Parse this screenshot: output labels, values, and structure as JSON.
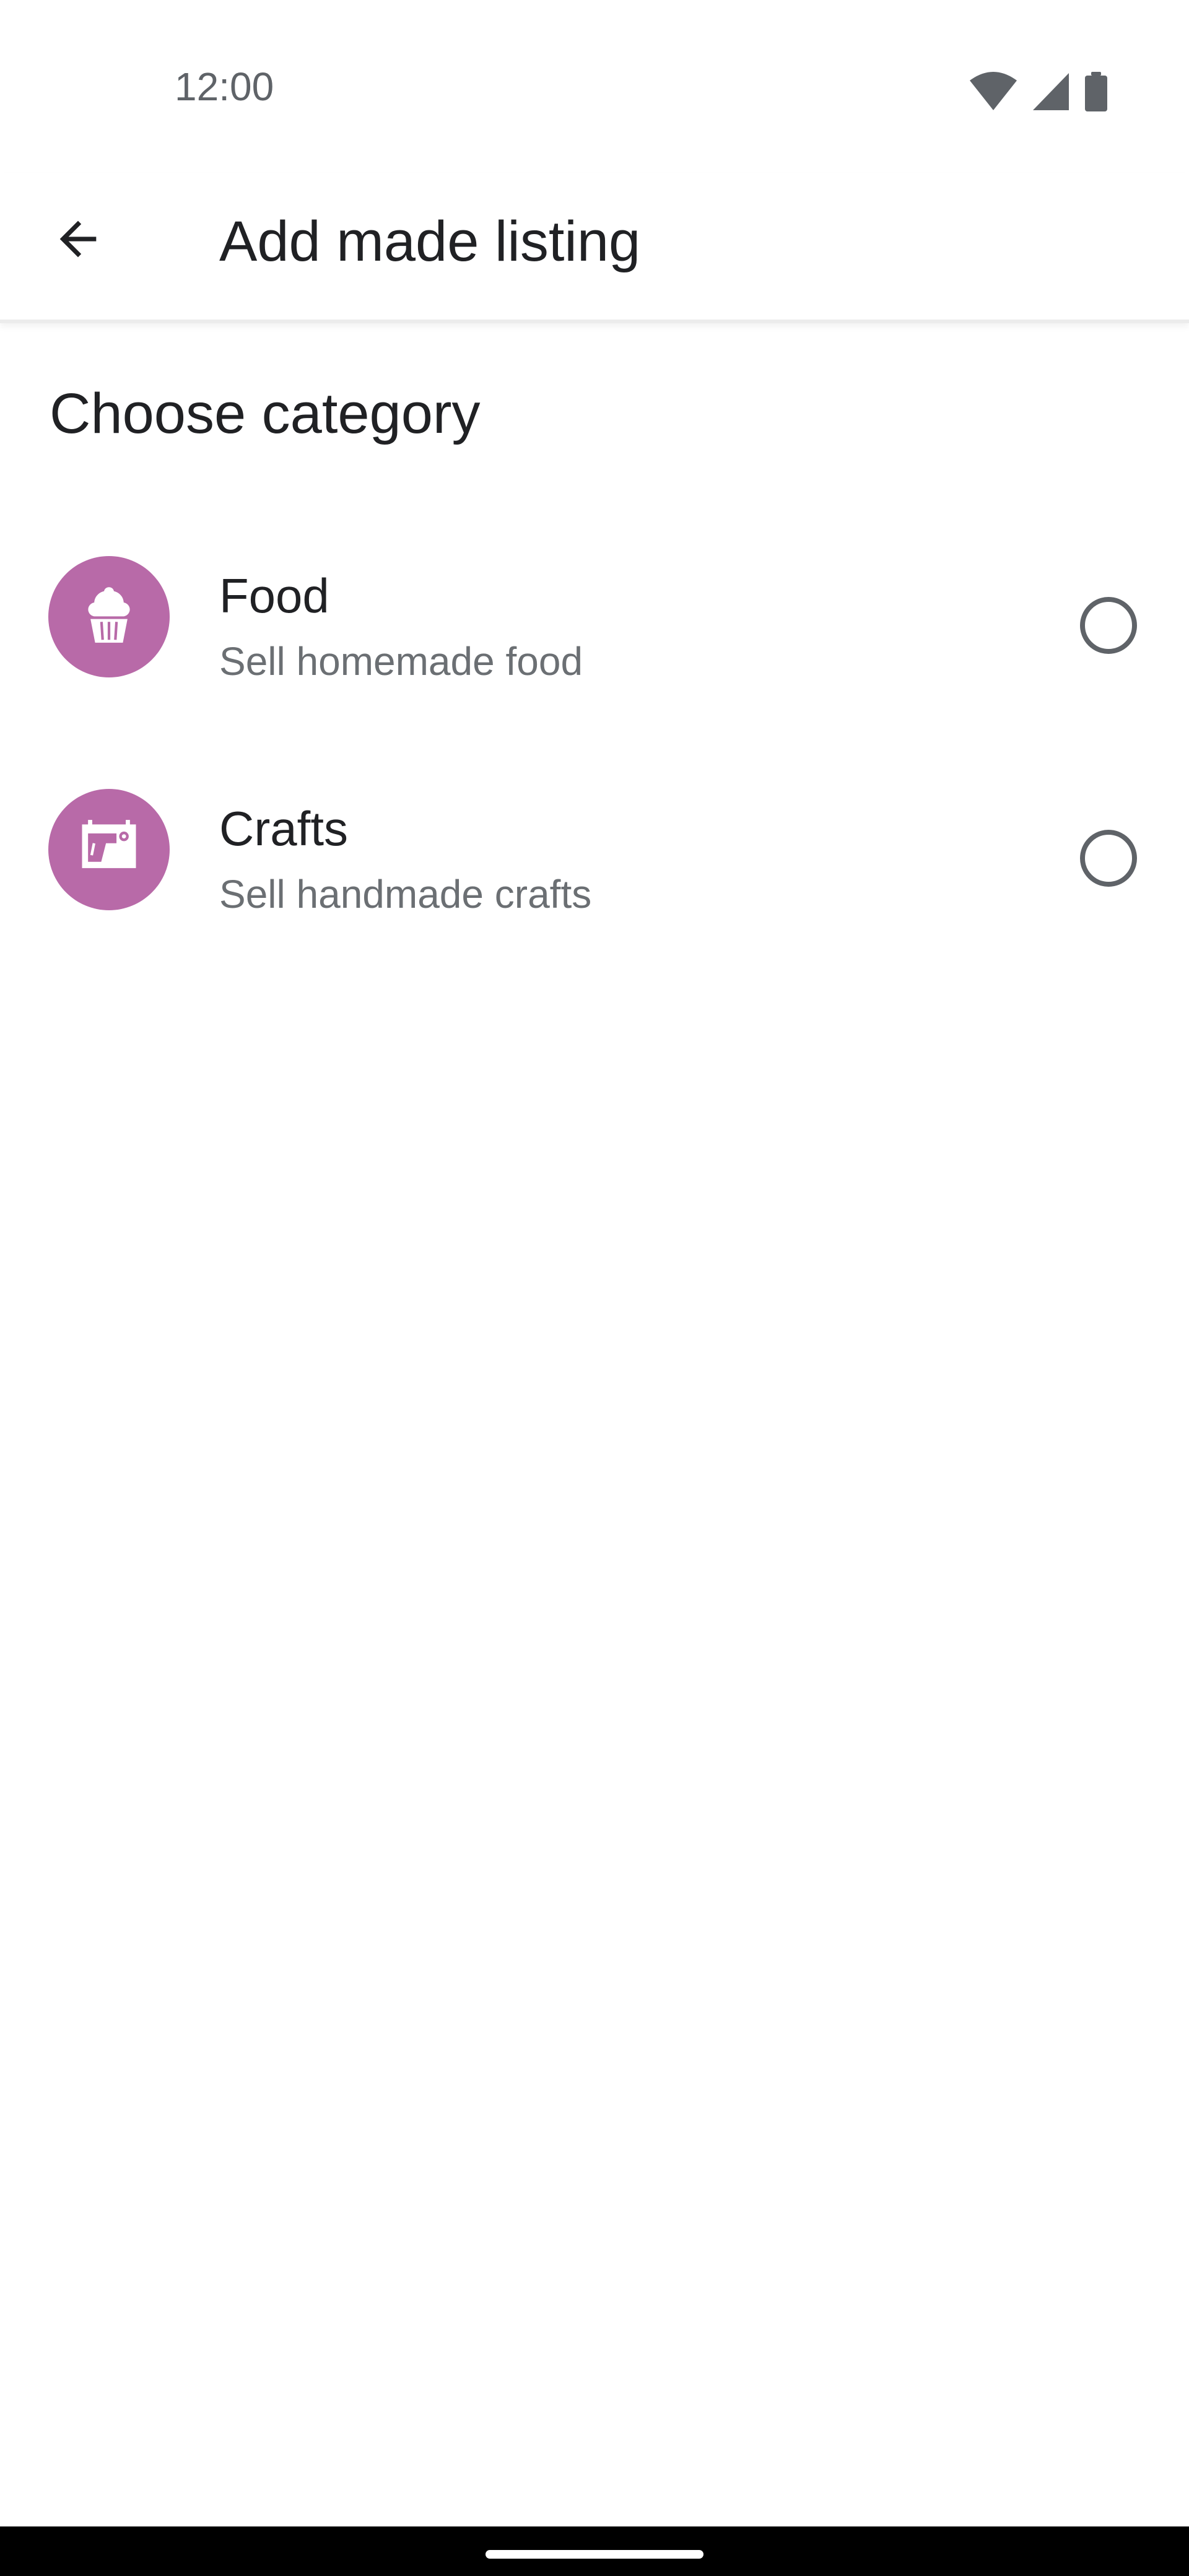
{
  "status_bar": {
    "time": "12:00",
    "icons": [
      "wifi-icon",
      "signal-icon",
      "battery-icon"
    ]
  },
  "app_bar": {
    "back_icon": "arrow-back-icon",
    "title": "Add made listing"
  },
  "content": {
    "section_title": "Choose category",
    "options": [
      {
        "icon": "cupcake-icon",
        "title": "Food",
        "subtitle": "Sell homemade food",
        "selected": false
      },
      {
        "icon": "sewing-machine-icon",
        "title": "Crafts",
        "subtitle": "Sell handmade crafts",
        "selected": false
      }
    ]
  },
  "colors": {
    "accent": "#b86aa8",
    "text_primary": "#202124",
    "text_secondary": "#6b6f73",
    "radio_border": "#5f6368"
  }
}
